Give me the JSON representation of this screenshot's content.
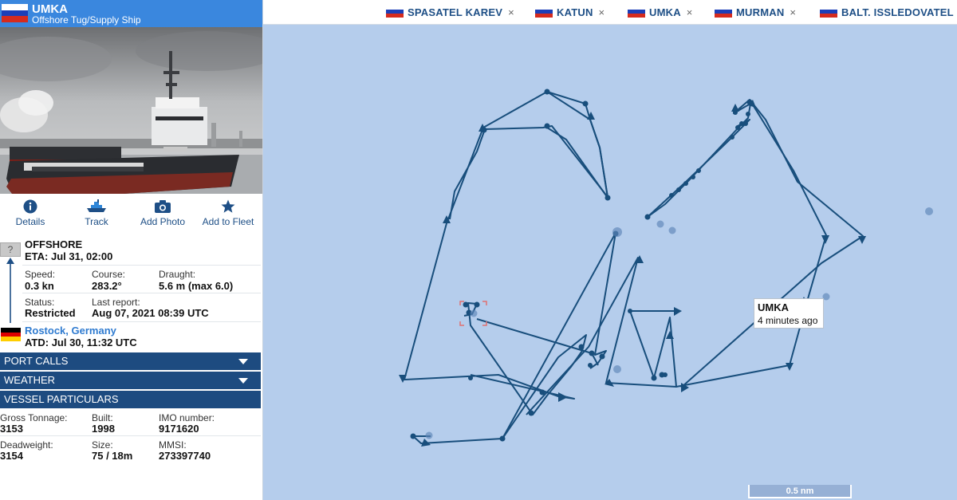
{
  "vessel": {
    "name": "UMKA",
    "type": "Offshore Tug/Supply Ship",
    "flag_icon": "russia-flag-icon"
  },
  "actions": [
    {
      "label": "Details",
      "icon": "info-icon"
    },
    {
      "label": "Track",
      "icon": "ship-track-icon"
    },
    {
      "label": "Add Photo",
      "icon": "camera-icon"
    },
    {
      "label": "Add to Fleet",
      "icon": "star-icon"
    }
  ],
  "voyage": {
    "unknown_icon": "?",
    "destination": "OFFSHORE",
    "eta": "ETA: Jul 31, 02:00",
    "speed_label": "Speed:",
    "speed": "0.3 kn",
    "course_label": "Course:",
    "course": "283.2°",
    "draught_label": "Draught:",
    "draught": "5.6 m (max 6.0)",
    "status_label": "Status:",
    "status": "Restricted",
    "last_report_label": "Last report:",
    "last_report": "Aug 07, 2021 08:39 UTC",
    "departure_port": "Rostock, Germany",
    "atd": "ATD: Jul 30, 11:32 UTC"
  },
  "sections": {
    "port_calls": "PORT CALLS",
    "weather": "WEATHER",
    "particulars": "VESSEL PARTICULARS"
  },
  "particulars": {
    "gross_tonnage_label": "Gross Tonnage:",
    "gross_tonnage": "3153",
    "built_label": "Built:",
    "built": "1998",
    "imo_label": "IMO number:",
    "imo": "9171620",
    "deadweight_label": "Deadweight:",
    "deadweight": "3154",
    "size_label": "Size:",
    "size": "75 / 18m",
    "mmsi_label": "MMSI:",
    "mmsi": "273397740"
  },
  "tabs": [
    {
      "name": "SPASATEL KAREV",
      "close": "×"
    },
    {
      "name": "KATUN",
      "close": "×"
    },
    {
      "name": "UMKA",
      "close": "×"
    },
    {
      "name": "MURMAN",
      "close": "×"
    },
    {
      "name": "BALT. ISSLEDOVATEL",
      "close": ""
    }
  ],
  "tooltip": {
    "name": "UMKA",
    "time": "4 minutes ago"
  },
  "scale": "0.5 nm",
  "colors": {
    "header_blue": "#3a87de",
    "section_navy": "#1d4b80",
    "map_water": "#b5cdec",
    "track_line": "#184e7c"
  }
}
